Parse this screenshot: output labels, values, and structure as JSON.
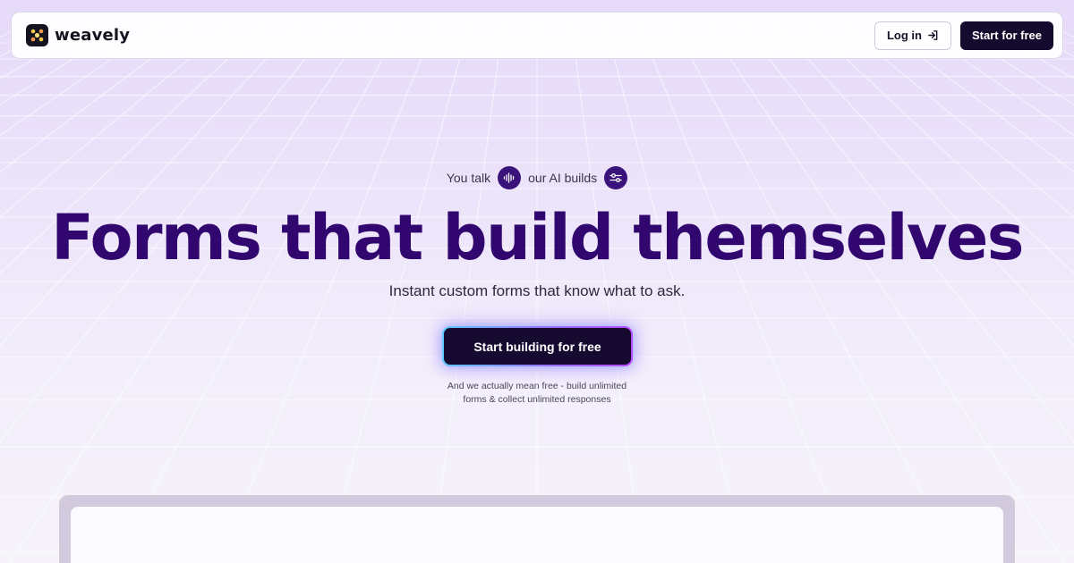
{
  "brand": {
    "name": "weavely"
  },
  "nav": {
    "login_label": "Log in",
    "start_label": "Start for free"
  },
  "hero": {
    "tagline_left": "You talk",
    "tagline_right": "our AI builds",
    "headline": "Forms that build themselves",
    "subheadline": "Instant custom forms that know what to ask.",
    "cta_label": "Start building for free",
    "fineprint_line1": "And we actually mean free - build unlimited",
    "fineprint_line2": "forms & collect unlimited responses"
  },
  "icons": {
    "logo": "weavely-logo-icon",
    "login": "login-arrow-icon",
    "voice": "audio-wave-icon",
    "settings": "sliders-icon"
  },
  "colors": {
    "headline": "#31066e",
    "dark_button": "#150b2e",
    "accent_circle": "#3a137a",
    "background": "#e6daf9"
  }
}
